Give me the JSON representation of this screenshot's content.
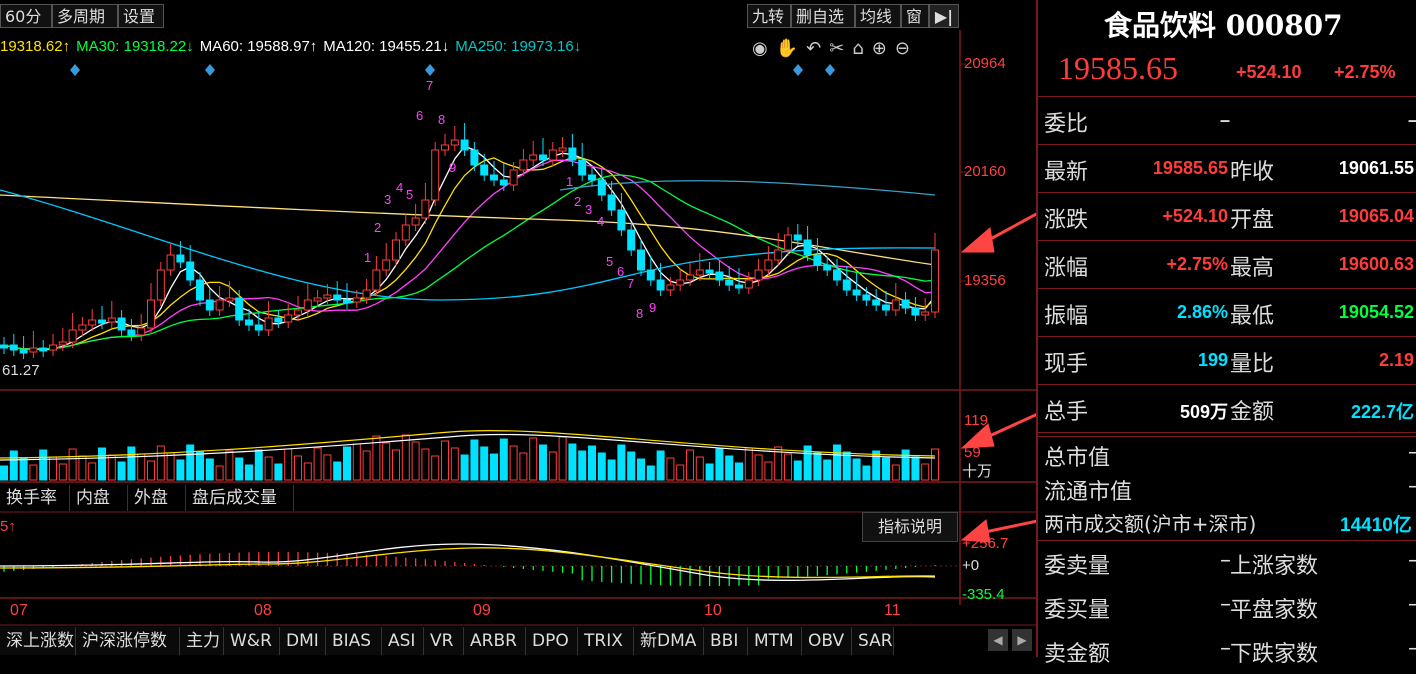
{
  "toolbar": {
    "period": "60分",
    "multi": "多周期",
    "settings": "设置",
    "right_buttons": [
      "九转",
      "删自选",
      "均线",
      "窗"
    ]
  },
  "ma_line": {
    "ma_prev": "19318.62↑",
    "ma30_label": "MA30: ",
    "ma30_value": "19318.22↓",
    "ma60_label": "MA60: ",
    "ma60_value": "19588.97↑",
    "ma120_label": "MA120: ",
    "ma120_value": "19455.21↓",
    "ma250_label": "MA250: ",
    "ma250_value": "19973.16↓"
  },
  "price_axis": [
    "20964",
    "20160",
    "19356"
  ],
  "low_marker": "61.27",
  "volume_axis": {
    "top": "119",
    "mid": "59",
    "unit": "十万"
  },
  "indicator_tabs": [
    "换手率",
    "内盘",
    "外盘",
    "盘后成交量"
  ],
  "macd": {
    "label": "5↑",
    "help": "指标说明",
    "top": "+256.7",
    "zero": "+0",
    "bottom": "-335.4"
  },
  "x_axis": [
    "07",
    "08",
    "09",
    "10",
    "11"
  ],
  "bottom_tabs": [
    "深上涨数",
    "沪深涨停数",
    "主力",
    "W&R",
    "DMI",
    "BIAS",
    "ASI",
    "VR",
    "ARBR",
    "DPO",
    "TRIX",
    "新DMA",
    "BBI",
    "MTM",
    "OBV",
    "SAR"
  ],
  "nine_turn_labels": [
    "1",
    "2",
    "3",
    "4",
    "5",
    "6",
    "7",
    "8",
    "9",
    "1",
    "2",
    "3",
    "4",
    "5",
    "6",
    "7",
    "8",
    "9"
  ],
  "quote": {
    "name": "食品饮料 000807",
    "price": "19585.65",
    "change": "+524.10",
    "pct": "+2.75%",
    "weibi_label": "委比",
    "weibi_v1": "–",
    "weibi_v2": "–",
    "rows": [
      {
        "l1": "最新",
        "v1": "19585.65",
        "c1": "#ff3c3c",
        "l2": "昨收",
        "v2": "19061.55",
        "c2": "#ffffff"
      },
      {
        "l1": "涨跌",
        "v1": "+524.10",
        "c1": "#ff3c3c",
        "l2": "开盘",
        "v2": "19065.04",
        "c2": "#ff3c3c"
      },
      {
        "l1": "涨幅",
        "v1": "+2.75%",
        "c1": "#ff3c3c",
        "l2": "最高",
        "v2": "19600.63",
        "c2": "#ff3c3c"
      },
      {
        "l1": "振幅",
        "v1": "2.86%",
        "c1": "#00e0ff",
        "l2": "最低",
        "v2": "19054.52",
        "c2": "#00ff40"
      },
      {
        "l1": "现手",
        "v1": "199",
        "c1": "#00e0ff",
        "l2": "量比",
        "v2": "2.19",
        "c2": "#ff3c3c"
      },
      {
        "l1": "总手",
        "v1": "509万",
        "c1": "#ffffff",
        "l2": "金额",
        "v2": "222.7亿",
        "c2": "#00e0ff"
      }
    ],
    "total_mv": "总市值",
    "total_mv_v": "–",
    "float_mv": "流通市值",
    "float_mv_v": "–",
    "two_market": "两市成交额(沪市+深市)",
    "two_market_v": "14410亿",
    "pairs": [
      {
        "l1": "委卖量",
        "v1": "–",
        "l2": "上涨家数",
        "v2": "–"
      },
      {
        "l1": "委买量",
        "v1": "–",
        "l2": "平盘家数",
        "v2": "–"
      },
      {
        "l1": "卖金额",
        "v1": "–",
        "l2": "下跌家数",
        "v2": "–"
      }
    ]
  },
  "colors": {
    "up": "#ff3c3c",
    "down": "#00e0ff",
    "border": "#7a1a1a",
    "yellow": "#ffe000",
    "magenta": "#ff40ff",
    "arrow": "#ff4444"
  }
}
